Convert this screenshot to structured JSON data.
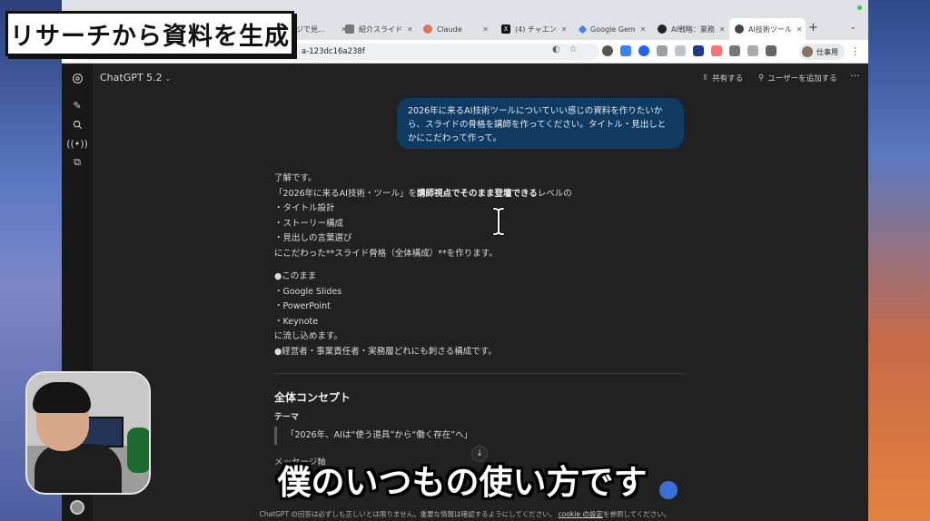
{
  "overlay": {
    "title_badge": "リサーチから資料を生成",
    "subtitle": "僕のいつもの使い方です"
  },
  "browser": {
    "tabs": [
      {
        "label": "ジで見...",
        "favicon_color": "#999999"
      },
      {
        "label": "紹介スライド",
        "favicon_color": "#555555"
      },
      {
        "label": "Claude",
        "favicon_color": "#d97757"
      },
      {
        "label": "(4) チャエン",
        "favicon_color": "#111111"
      },
      {
        "label": "Google Gem",
        "favicon_color": "#4285f4"
      },
      {
        "label": "AI戦略：業務",
        "favicon_color": "#222222"
      },
      {
        "label": "AI技術ツール",
        "favicon_color": "#444444",
        "active": true
      }
    ],
    "url": "a-123dc16a238f",
    "profile_label": "仕事用"
  },
  "app": {
    "model_name": "ChatGPT 5.2",
    "share_label": "共有する",
    "add_user_label": "ユーザーを追加する"
  },
  "conversation": {
    "user_message": "2026年に来るAI技術ツールについていい感じの資料を作りたいから、スライドの骨格を講師を作ってください。タイトル・見出しとかにこだわって作って。",
    "response": {
      "l1": "了解です。",
      "l2_pre": "「2026年に来るAI技術・ツール」を",
      "l2_bold": "講師視点でそのまま登壇できる",
      "l2_post": "レベルの",
      "l3": "・タイトル設計",
      "l4": "・ストーリー構成",
      "l5": "・見出しの言葉選び",
      "l6": "にこだわった**スライド骨格（全体構成）**を作ります。",
      "l7": "●このまま",
      "l8": "・Google Slides",
      "l9": "・PowerPoint",
      "l10": "・Keynote",
      "l11": "に流し込めます。",
      "l12": "●経営者・事業責任者・実務層どれにも刺さる構成です。"
    },
    "section_title": "全体コンセプト",
    "theme_label": "テーマ",
    "theme_quote": "「2026年、AIは“使う道具”から“働く存在”へ」",
    "message_axis_label": "メッセージ軸"
  },
  "footer": {
    "text": "ChatGPT の回答は必ずしも正しいとは限りません。重要な情報は確認するようにしてください。",
    "link": "cookie の設定",
    "suffix": "を参照してください。"
  }
}
